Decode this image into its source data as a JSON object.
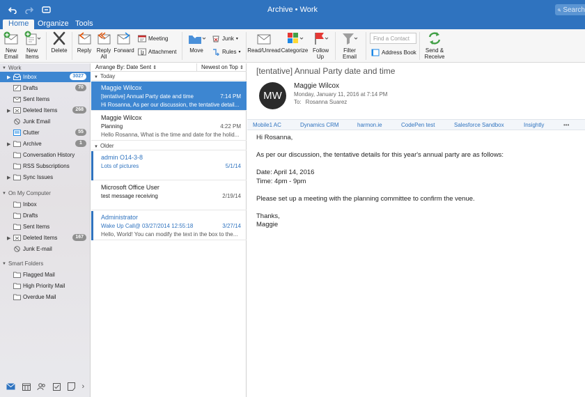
{
  "window": {
    "title": "Archive • Work",
    "search_placeholder": "Search"
  },
  "quick_access": [
    "undo-icon",
    "redo-icon",
    "customize-icon"
  ],
  "tabs": [
    {
      "label": "Home",
      "active": true
    },
    {
      "label": "Organize"
    },
    {
      "label": "Tools"
    }
  ],
  "ribbon": {
    "new_email": "New Email",
    "new_items": "New Items",
    "delete": "Delete",
    "reply": "Reply",
    "reply_all": "Reply All",
    "forward": "Forward",
    "meeting": "Meeting",
    "attachment": "Attachment",
    "move": "Move",
    "junk": "Junk",
    "rules": "Rules",
    "read_unread": "Read/Unread",
    "categorize": "Categorize",
    "follow_up": "Follow Up",
    "filter_email": "Filter Email",
    "find_contact_placeholder": "Find a Contact",
    "address_book": "Address Book",
    "send_receive": "Send & Receive"
  },
  "sidebar": {
    "work": {
      "header": "Work",
      "items": [
        {
          "label": "Inbox",
          "badge": "3027",
          "selected": true
        },
        {
          "label": "Drafts",
          "badge": "70"
        },
        {
          "label": "Sent Items"
        },
        {
          "label": "Deleted Items",
          "badge": "268"
        },
        {
          "label": "Junk Email"
        },
        {
          "label": "Clutter",
          "badge": "55"
        },
        {
          "label": "Archive",
          "badge": "1"
        },
        {
          "label": "Conversation History"
        },
        {
          "label": "RSS Subscriptions"
        },
        {
          "label": "Sync Issues"
        }
      ]
    },
    "computer": {
      "header": "On My Computer",
      "items": [
        {
          "label": "Inbox"
        },
        {
          "label": "Drafts"
        },
        {
          "label": "Sent Items"
        },
        {
          "label": "Deleted Items",
          "badge": "167"
        },
        {
          "label": "Junk E-mail"
        }
      ]
    },
    "smart": {
      "header": "Smart Folders",
      "items": [
        {
          "label": "Flagged Mail"
        },
        {
          "label": "High Priority Mail"
        },
        {
          "label": "Overdue Mail"
        }
      ]
    },
    "bottom_nav": [
      "mail-icon",
      "calendar-icon",
      "people-icon",
      "tasks-icon",
      "notes-icon",
      "more-icon"
    ]
  },
  "list": {
    "arrange_by": "Arrange By: Date Sent",
    "sort": "Newest on Top",
    "groups": [
      {
        "label": "Today",
        "messages": [
          {
            "from": "Maggie Wilcox",
            "subject": "[tentative] Annual Party date and time",
            "preview": "Hi Rosanna, As per our discussion, the tentative detail...",
            "date": "7:14 PM"
          },
          {
            "from": "Maggie Wilcox",
            "subject": "Planning",
            "preview": "Hello Rosanna, What is the time and date for the holid...",
            "date": "4:22 PM"
          }
        ]
      },
      {
        "label": "Older",
        "messages": [
          {
            "from": "admin O14-3-8",
            "subject": "Lots of pictures",
            "preview": "",
            "date": "5/1/14"
          },
          {
            "from": "Microsoft Office User",
            "subject": "test message receiving",
            "preview": "",
            "date": "2/19/14"
          },
          {
            "from": "Administrator",
            "subject": "Wake Up Call@ 03/27/2014 12:55:18",
            "preview": "Hello, World! You can modify the text in the box to the...",
            "date": "3/27/14"
          }
        ]
      }
    ]
  },
  "reading": {
    "subject": "[tentative] Annual Party date and time",
    "avatar_initials": "MW",
    "sender": "Maggie Wilcox",
    "date": "Monday, January 11, 2016 at 7:14 PM",
    "to_label": "To:",
    "to": "Rosanna Suarez",
    "addins": [
      "Mobile1 AC",
      "Dynamics CRM",
      "harmon.ie",
      "CodePen test",
      "Salesforce Sandbox",
      "Insightly",
      "•••"
    ],
    "body": {
      "greeting": "Hi Rosanna,",
      "intro": "As per our discussion, the tentative details for this year's annual party are as follows:",
      "date_line": "Date: April 14, 2016",
      "time_line": "Time: 4pm - 9pm",
      "request": "Please set up a meeting with the planning committee to confirm the venue.",
      "closing": "Thanks,",
      "signature": "Maggie"
    }
  },
  "colors": {
    "brand": "#2f73bf",
    "selection": "#3d86d1",
    "ribbon_bg": "#f6f6f6"
  }
}
